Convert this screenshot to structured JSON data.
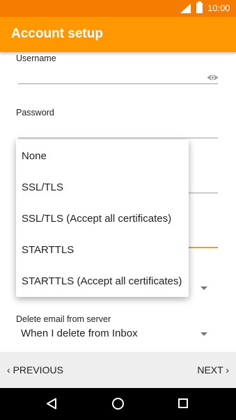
{
  "status_bar": {
    "time": "10:00"
  },
  "app_bar": {
    "title": "Account setup"
  },
  "form": {
    "username_label": "Username",
    "password_label": "Password",
    "delete_label": "Delete email from server",
    "delete_value": "When I delete from Inbox"
  },
  "dropdown": {
    "options": [
      "None",
      "SSL/TLS",
      "SSL/TLS (Accept all certificates)",
      "STARTTLS",
      "STARTTLS (Accept all certificates)"
    ]
  },
  "nav": {
    "previous": "PREVIOUS",
    "next": "NEXT",
    "prev_chevron": "‹",
    "next_chevron": "›"
  },
  "colors": {
    "status_bar": "#f57c00",
    "app_bar": "#ff9800",
    "accent": "#ff9800"
  }
}
